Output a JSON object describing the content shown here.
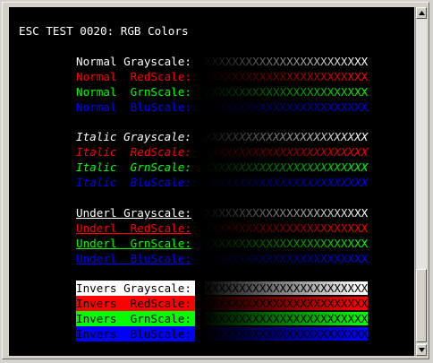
{
  "title": "ESC TEST 0020: RGB Colors",
  "xstring": "XXXXXXXXXXXXXXXXXXXXXXXX",
  "groups": [
    {
      "style": "normal",
      "rows": [
        {
          "label": "Normal Grayscale:",
          "channel": "gray",
          "color": "#ffffff"
        },
        {
          "label": "Normal  RedScale:",
          "channel": "red",
          "color": "#ff0000"
        },
        {
          "label": "Normal  GrnScale:",
          "channel": "green",
          "color": "#00ff00"
        },
        {
          "label": "Normal  BluScale:",
          "channel": "blue",
          "color": "#0000ff"
        }
      ]
    },
    {
      "style": "italic",
      "rows": [
        {
          "label": "Italic Grayscale:",
          "channel": "gray",
          "color": "#ffffff"
        },
        {
          "label": "Italic  RedScale:",
          "channel": "red",
          "color": "#ff0000"
        },
        {
          "label": "Italic  GrnScale:",
          "channel": "green",
          "color": "#00ff00"
        },
        {
          "label": "Italic  BluScale:",
          "channel": "blue",
          "color": "#0000ff"
        }
      ]
    },
    {
      "style": "underline",
      "rows": [
        {
          "label": "Underl Grayscale:",
          "channel": "gray",
          "color": "#ffffff"
        },
        {
          "label": "Underl  RedScale:",
          "channel": "red",
          "color": "#ff0000"
        },
        {
          "label": "Underl  GrnScale:",
          "channel": "green",
          "color": "#00ff00"
        },
        {
          "label": "Underl  BluScale:",
          "channel": "blue",
          "color": "#0000ff"
        }
      ]
    },
    {
      "style": "inverse",
      "rows": [
        {
          "label": "Invers Grayscale:",
          "channel": "gray",
          "color": "#ffffff"
        },
        {
          "label": "Invers  RedScale:",
          "channel": "red",
          "color": "#ff0000"
        },
        {
          "label": "Invers  GrnScale:",
          "channel": "green",
          "color": "#00ff00"
        },
        {
          "label": "Invers  BluScale:",
          "channel": "blue",
          "color": "#0000ff"
        }
      ]
    }
  ],
  "colors": {
    "terminal_bg": "#000000",
    "title_fg": "#ffffff"
  }
}
